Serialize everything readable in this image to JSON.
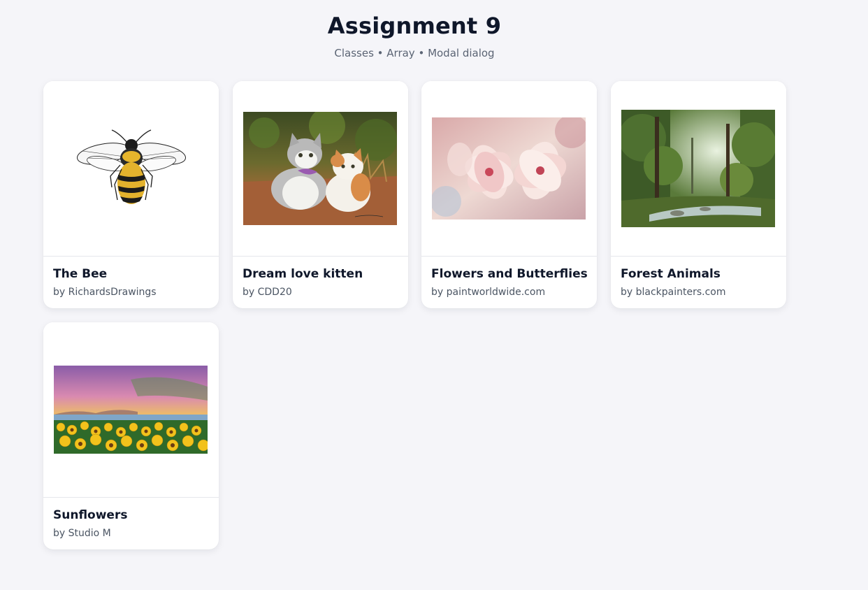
{
  "page": {
    "title": "Assignment 9",
    "subtitle": "Classes • Array • Modal dialog"
  },
  "gallery": {
    "cards": [
      {
        "title": "The Bee",
        "author": "by RichardsDrawings",
        "image": "bee-drawing"
      },
      {
        "title": "Dream love kitten",
        "author": "by CDD20",
        "image": "kittens-painting"
      },
      {
        "title": "Flowers and Butterflies",
        "author": "by paintworldwide.com",
        "image": "pink-flowers-watercolor"
      },
      {
        "title": "Forest Animals",
        "author": "by blackpainters.com",
        "image": "forest-painting"
      },
      {
        "title": "Sunflowers",
        "author": "by Studio M",
        "image": "sunflower-field-painting"
      }
    ]
  }
}
